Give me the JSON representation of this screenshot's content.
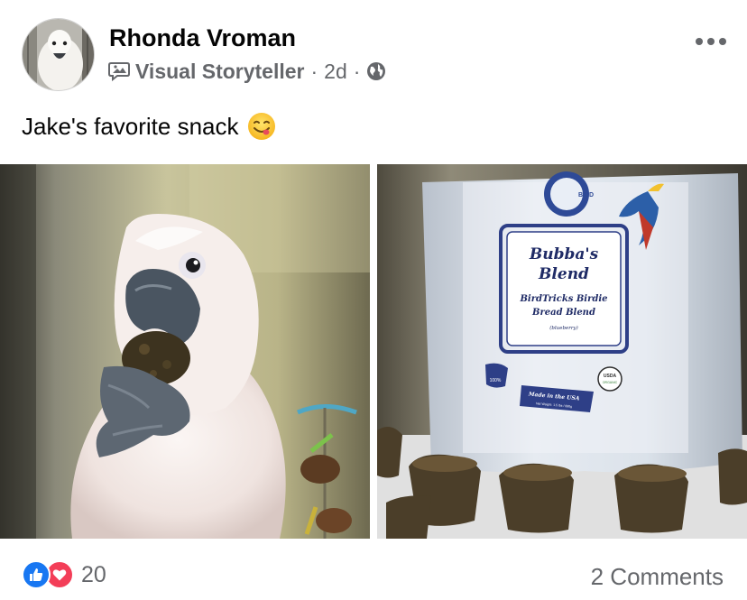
{
  "post": {
    "author": "Rhonda Vroman",
    "badge": "Visual Storyteller",
    "separator": "·",
    "time": "2d",
    "text": "Jake's favorite snack",
    "emoji": "yum-face-emoji"
  },
  "photos": [
    {
      "name": "cockatoo-eating-photo"
    },
    {
      "name": "bubbas-blend-bag-photo",
      "bag_label": {
        "brand": "BIRD",
        "title_line1": "Bubba's",
        "title_line2": "Blend",
        "sub_line1": "BirdTricks Birdie",
        "sub_line2": "Bread Blend",
        "flavor": "(blueberry)",
        "ribbon_line1": "Made in the USA",
        "ribbon_line2": "Net Weight: 1.5 lbs / 680g",
        "seal_top": "USDA",
        "seal_bottom": "ORGANIC",
        "percent": "100%"
      }
    }
  ],
  "footer": {
    "reaction_count": "20",
    "comments_label": "2 Comments"
  },
  "colors": {
    "like": "#1877f2",
    "love": "#f33e58",
    "secondary_text": "#65676b"
  }
}
